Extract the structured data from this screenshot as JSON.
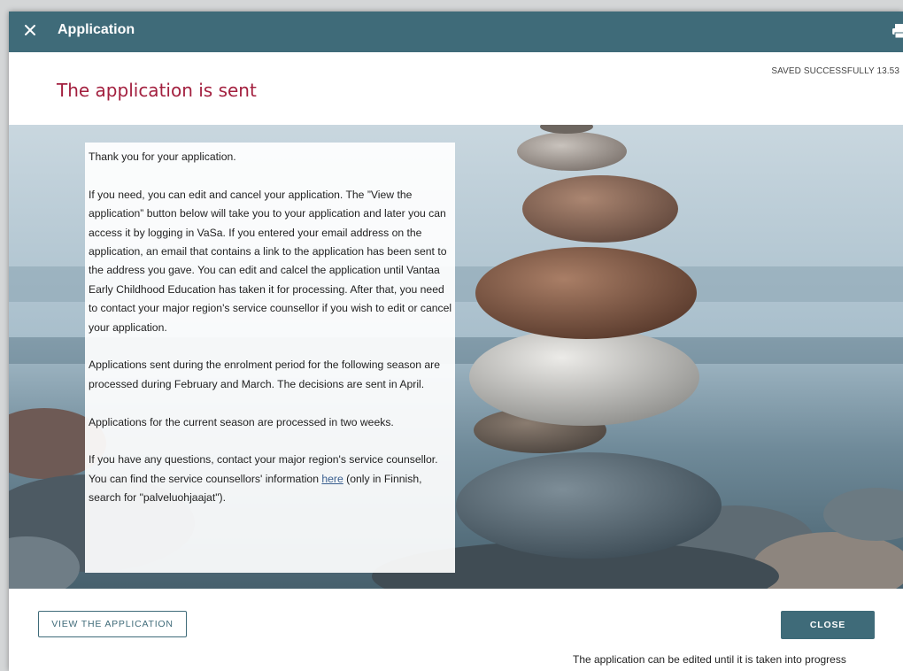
{
  "window": {
    "title": "Application",
    "saved_status": "SAVED SUCCESSFULLY 13.53"
  },
  "main": {
    "heading": "The application is sent",
    "paragraphs": {
      "p1": "Thank you for your application.",
      "p2": "If you need, you can edit and cancel your application. The ”View the application” button below will take you to your application and later you can access it by logging in VaSa. If you entered your email address on the application, an email that contains a link to the application has been sent to the address you gave. You can edit and calcel the application until Vantaa Early Childhood Education has taken it for processing. After that, you need to contact your major region's service counsellor if you wish to edit or cancel your application.",
      "p3": "Applications sent during the enrolment period for the following season are processed during February and March. The decisions are sent in April.",
      "p4": "Applications for the current season are processed in two weeks.",
      "p5_before": "If you have any questions, contact your major region's service counsellor. You can find the service counsellors' information ",
      "p5_link": "here",
      "p5_after": " (only in Finnish, search for \"palveluohjaajat\")."
    }
  },
  "footer": {
    "view_button": "VIEW THE APPLICATION",
    "close_button": "CLOSE",
    "note": "The application can be edited until it is taken into progress"
  },
  "icons": {
    "close": "close-icon",
    "print": "printer-icon"
  },
  "colors": {
    "header_bg": "#3f6b79",
    "heading_text": "#a3203f",
    "button_primary": "#3f6b79"
  }
}
